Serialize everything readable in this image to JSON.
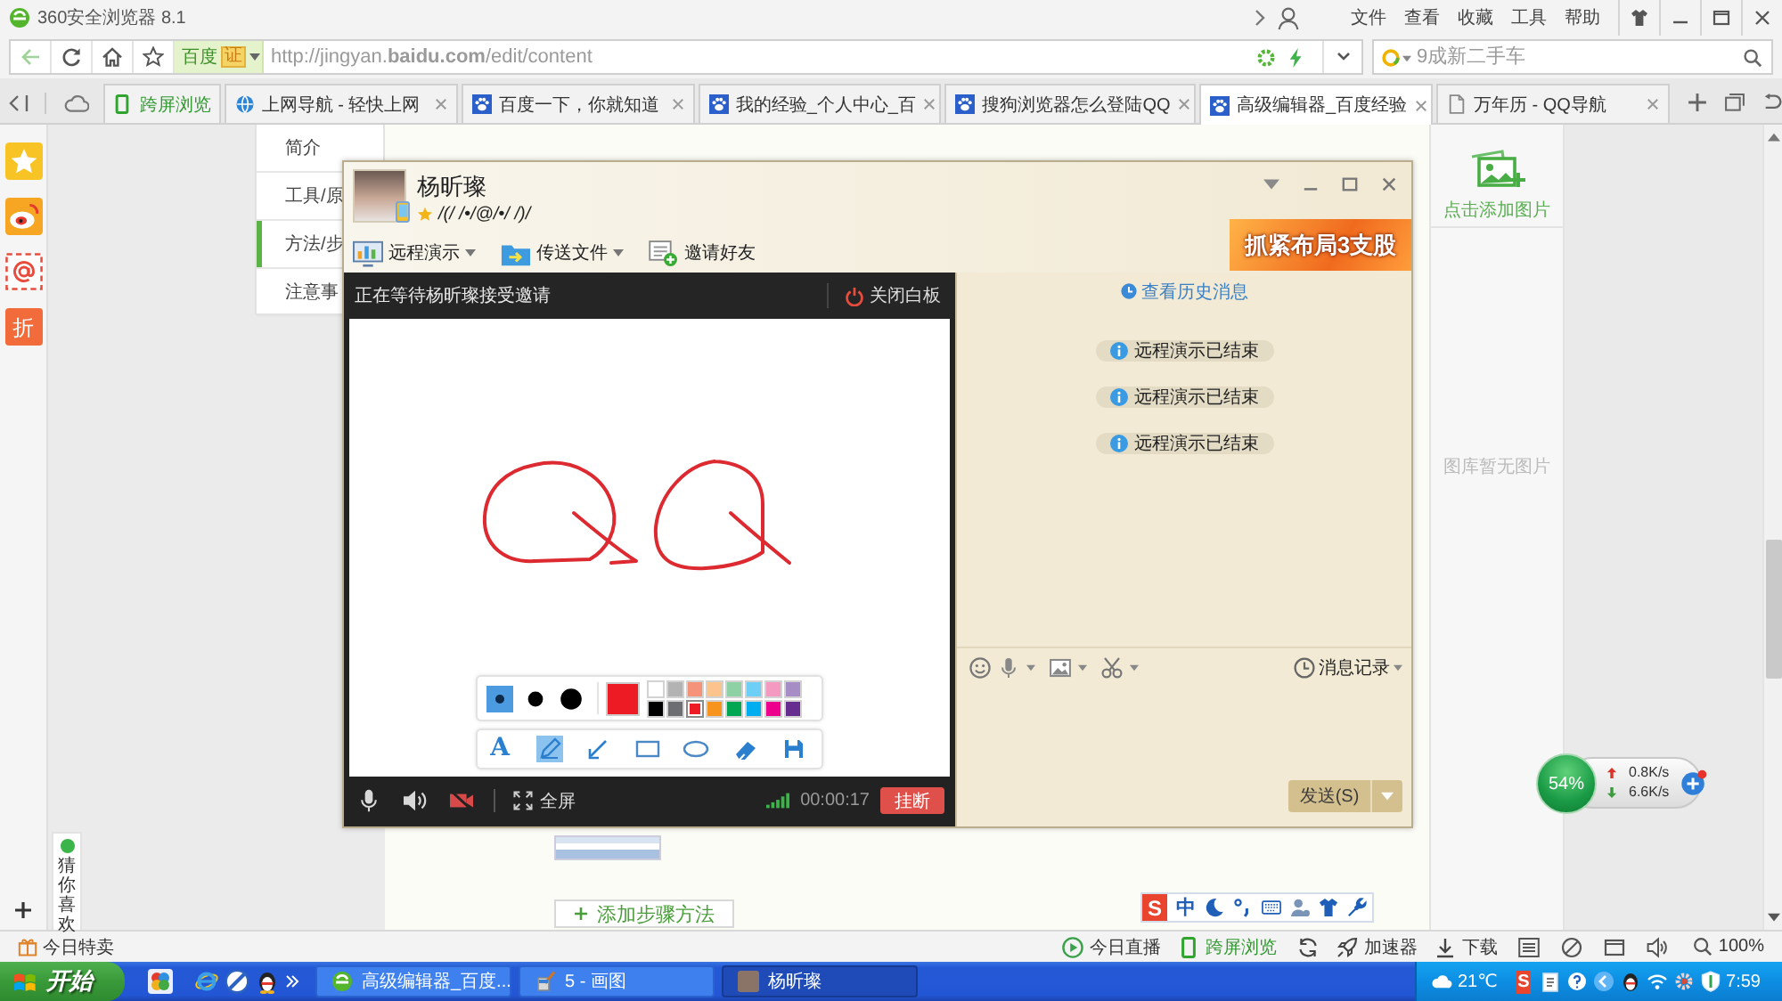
{
  "browser": {
    "title": "360安全浏览器 8.1",
    "menu": [
      "文件",
      "查看",
      "收藏",
      "工具",
      "帮助"
    ]
  },
  "address_bar": {
    "engine": "百度",
    "badge": "证",
    "url": "http://jingyan.**baidu.com**/edit/content",
    "search": {
      "placeholder": "9成新二手车"
    }
  },
  "tabs": [
    {
      "label": "跨屏浏览",
      "kind": "pinned",
      "selected": false
    },
    {
      "label": "上网导航 - 轻快上网",
      "kind": "globe",
      "selected": false
    },
    {
      "label": "百度一下，你就知道",
      "kind": "paw",
      "selected": false
    },
    {
      "label": "我的经验_个人中心_百",
      "kind": "paw",
      "selected": false
    },
    {
      "label": "搜狗浏览器怎么登陆QQ",
      "kind": "paw",
      "selected": false
    },
    {
      "label": "高级编辑器_百度经验",
      "kind": "paw",
      "selected": true
    },
    {
      "label": "万年历 - QQ导航",
      "kind": "page",
      "selected": false
    }
  ],
  "sidebar": {
    "badge": "折",
    "recommend": "猜你喜欢"
  },
  "page": {
    "nav": [
      {
        "label": "简介",
        "selected": false
      },
      {
        "label": "工具/原",
        "selected": false
      },
      {
        "label": "方法/步",
        "selected": true
      },
      {
        "label": "注意事",
        "selected": false
      }
    ],
    "add_step": "添加步骤方法",
    "gallery": {
      "add": "点击添加图片",
      "empty": "图库暂无图片"
    }
  },
  "qq": {
    "contact": {
      "name": "杨昕璨",
      "signature": "/(/ /•/@/•/ /)/"
    },
    "toolbar": [
      {
        "label": "远程演示",
        "kind": "present",
        "dropdown": true
      },
      {
        "label": "传送文件",
        "kind": "file",
        "dropdown": true
      },
      {
        "label": "邀请好友",
        "kind": "invite",
        "dropdown": false
      }
    ],
    "ad": "抓紧布局3支股",
    "whiteboard": {
      "status": "正在等待杨昕璨接受邀请",
      "close": "关闭白板",
      "sizes": [
        {
          "selected": true
        },
        {
          "selected": false
        },
        {
          "selected": false
        }
      ],
      "palette": [
        {
          "color": "#ffffff",
          "selected": false
        },
        {
          "color": "#b3b3b3",
          "selected": false
        },
        {
          "color": "#f4927a",
          "selected": false
        },
        {
          "color": "#fbc48d",
          "selected": false
        },
        {
          "color": "#8ed1a5",
          "selected": false
        },
        {
          "color": "#6dcff6",
          "selected": false
        },
        {
          "color": "#f49ac1",
          "selected": false
        },
        {
          "color": "#a68dc6",
          "selected": false
        },
        {
          "color": "#000000",
          "selected": false
        },
        {
          "color": "#6d6e71",
          "selected": false
        },
        {
          "color": "#ed1c24",
          "selected": true
        },
        {
          "color": "#f7941d",
          "selected": false
        },
        {
          "color": "#00a651",
          "selected": false
        },
        {
          "color": "#00aeef",
          "selected": false
        },
        {
          "color": "#ec008c",
          "selected": false
        },
        {
          "color": "#662d91",
          "selected": false
        }
      ],
      "tools": [
        {
          "kind": "text",
          "symbol": "A",
          "selected": false
        },
        {
          "kind": "pencil",
          "selected": true
        },
        {
          "kind": "arrow",
          "selected": false
        },
        {
          "kind": "rectangle",
          "selected": false
        },
        {
          "kind": "ellipse",
          "selected": false
        },
        {
          "kind": "eraser",
          "selected": false
        },
        {
          "kind": "save",
          "selected": false
        }
      ],
      "fullscreen": "全屏",
      "timer": "00:00:17",
      "hangup": "挂断"
    },
    "chat": {
      "history": "查看历史消息",
      "messages": [
        "远程演示已结束",
        "远程演示已结束",
        "远程演示已结束"
      ],
      "record": "消息记录",
      "send": "发送(S)"
    }
  },
  "ime": {
    "logo": "S",
    "mode": "中"
  },
  "speed": {
    "percent": "54%",
    "upload": "0.8K/s",
    "download": "6.6K/s"
  },
  "status_bar": {
    "deals": "今日特卖",
    "items": [
      {
        "label": "今日直播",
        "kind": "live"
      },
      {
        "label": "跨屏浏览",
        "kind": "phone"
      },
      {
        "label": "加速器",
        "kind": "rocket"
      },
      {
        "label": "下载",
        "kind": "download"
      }
    ],
    "zoom": "100%"
  },
  "taskbar": {
    "start": "开始",
    "tasks": [
      {
        "label": "高级编辑器_百度...",
        "kind": "browser",
        "selected": false
      },
      {
        "label": "5 - 画图",
        "kind": "paint",
        "selected": false
      },
      {
        "label": "杨昕璨",
        "kind": "chat",
        "selected": true
      }
    ],
    "ime_logo": "S",
    "weather": "21℃",
    "clock": "7:59"
  }
}
